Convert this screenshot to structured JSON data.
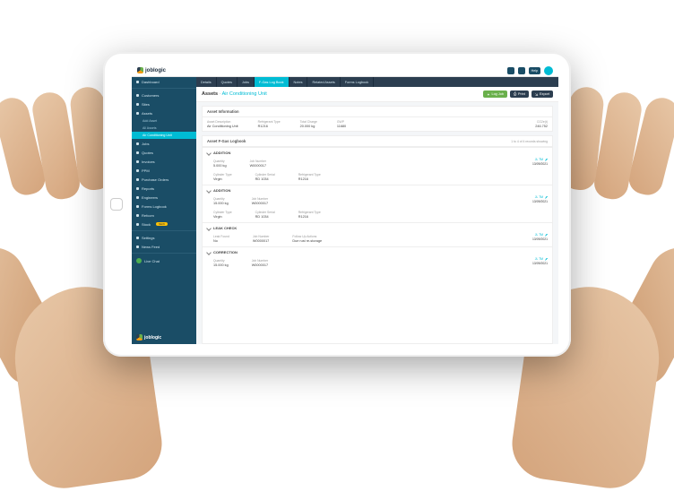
{
  "brand": "joblogic",
  "topbar": {
    "help": "Help"
  },
  "sidebar": {
    "items": [
      {
        "label": "Dashboard"
      },
      {
        "label": "Customers"
      },
      {
        "label": "Sites"
      },
      {
        "label": "Assets",
        "expanded": true,
        "children": [
          {
            "label": "Add Asset"
          },
          {
            "label": "All Assets"
          },
          {
            "label": "Air Conditioning Unit",
            "active": true
          }
        ]
      },
      {
        "label": "Jobs"
      },
      {
        "label": "Quotes"
      },
      {
        "label": "Invoices"
      },
      {
        "label": "PPM"
      },
      {
        "label": "Purchase Orders"
      },
      {
        "label": "Reports"
      },
      {
        "label": "Engineers"
      },
      {
        "label": "Forms Logbook"
      },
      {
        "label": "Refcom"
      },
      {
        "label": "Stock",
        "badge": "NEW"
      }
    ],
    "footer": [
      {
        "label": "Settings"
      },
      {
        "label": "News Feed"
      }
    ],
    "chat": "Live Chat"
  },
  "tabs": [
    {
      "label": "Details"
    },
    {
      "label": "Quotes"
    },
    {
      "label": "Jobs"
    },
    {
      "label": "F-Gas Log Book",
      "active": true
    },
    {
      "label": "Notes"
    },
    {
      "label": "Related Assets"
    },
    {
      "label": "Forms Logbook"
    }
  ],
  "page": {
    "title": "Assets",
    "subtitle": "Air Conditioning Unit",
    "buttons": {
      "logjob": "Log Job",
      "print": "Print",
      "export": "Export"
    }
  },
  "asset_info": {
    "heading": "Asset Information",
    "fields": [
      {
        "lbl": "Asset Description",
        "val": "Air Conditioning Unit"
      },
      {
        "lbl": "Refrigerant Type",
        "val": "R1216"
      },
      {
        "lbl": "Total Charge",
        "val": "20.000 kg"
      },
      {
        "lbl": "GWP",
        "val": "11680"
      },
      {
        "lbl": "CO2e(t)",
        "val": "246.752"
      }
    ]
  },
  "logbook": {
    "heading": "Asset F-Gas Logbook",
    "count": "1 to 4 of 4 records showing",
    "entries": [
      {
        "type": "ADDITION",
        "user": "JL TM",
        "date": "13/09/2021",
        "row1": [
          {
            "lbl": "Quantity",
            "val": "5.000 kg"
          },
          {
            "lbl": "Job Number",
            "val": "W0000017",
            "link": true
          }
        ],
        "row2": [
          {
            "lbl": "Cylinder Type",
            "val": "Virgin"
          },
          {
            "lbl": "Cylinder Serial",
            "val": "RD 1034"
          },
          {
            "lbl": "Refrigerant Type",
            "val": "R1216"
          }
        ]
      },
      {
        "type": "ADDITION",
        "user": "JL TM",
        "date": "13/09/2021",
        "row1": [
          {
            "lbl": "Quantity",
            "val": "15.000 kg"
          },
          {
            "lbl": "Job Number",
            "val": "W0000017",
            "link": true
          }
        ],
        "row2": [
          {
            "lbl": "Cylinder Type",
            "val": "Virgin"
          },
          {
            "lbl": "Cylinder Serial",
            "val": "RD 1034"
          },
          {
            "lbl": "Refrigerant Type",
            "val": "R1216"
          }
        ]
      },
      {
        "type": "LEAK CHECK",
        "user": "JL TM",
        "date": "13/09/2021",
        "row1": [
          {
            "lbl": "Leak Found",
            "val": "No",
            "red": true
          },
          {
            "lbl": "Job Number",
            "val": "W0000017",
            "link": true
          },
          {
            "lbl": "Follow Up Actions",
            "val": "Due rust re-storage"
          }
        ]
      },
      {
        "type": "CORRECTION",
        "user": "JL TM",
        "date": "13/09/2021",
        "row1": [
          {
            "lbl": "Quantity",
            "val": "15.000 kg"
          },
          {
            "lbl": "Job Number",
            "val": "W0000017",
            "link": true
          }
        ]
      }
    ]
  }
}
